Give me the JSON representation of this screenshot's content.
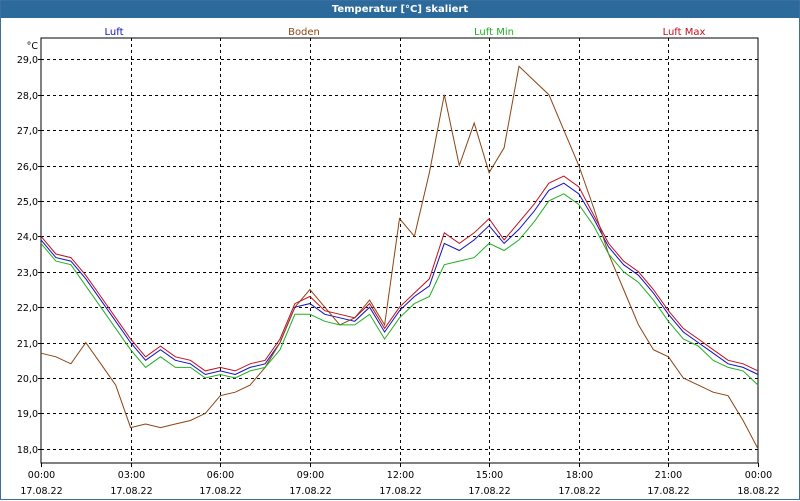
{
  "window": {
    "title": "Temperatur [°C] skaliert"
  },
  "chart_data": {
    "type": "line",
    "title": "Temperatur [°C] skaliert",
    "ylabel": "°C",
    "ylim": [
      17.6,
      29.6
    ],
    "yticks": [
      18.0,
      19.0,
      20.0,
      21.0,
      22.0,
      23.0,
      24.0,
      25.0,
      26.0,
      27.0,
      28.0,
      29.0
    ],
    "ytick_labels": [
      "18,0",
      "19,0",
      "20,0",
      "21,0",
      "22,0",
      "23,0",
      "24,0",
      "25,0",
      "26,0",
      "27,0",
      "28,0",
      "29,0"
    ],
    "xlim": [
      0,
      24
    ],
    "x_ticks": [
      0,
      3,
      6,
      9,
      12,
      15,
      18,
      21,
      24
    ],
    "x_tick_times": [
      "00:00",
      "03:00",
      "06:00",
      "09:00",
      "12:00",
      "15:00",
      "18:00",
      "21:00",
      "00:00"
    ],
    "x_tick_dates": [
      "17.08.22",
      "17.08.22",
      "17.08.22",
      "17.08.22",
      "17.08.22",
      "17.08.22",
      "17.08.22",
      "17.08.22",
      "18.08.22"
    ],
    "grid": true,
    "legend_position": "top",
    "series": [
      {
        "name": "Luft",
        "color": "#1010c0",
        "x": [
          0,
          0.5,
          1,
          1.5,
          2,
          2.5,
          3,
          3.5,
          4,
          4.5,
          5,
          5.5,
          6,
          6.5,
          7,
          7.5,
          8,
          8.5,
          9,
          9.5,
          10,
          10.5,
          11,
          11.5,
          12,
          12.5,
          13,
          13.5,
          14,
          14.5,
          15,
          15.5,
          16,
          16.5,
          17,
          17.5,
          18,
          18.5,
          19,
          19.5,
          20,
          20.5,
          21,
          21.5,
          22,
          22.5,
          23,
          23.5,
          24
        ],
        "y": [
          23.9,
          23.4,
          23.3,
          22.8,
          22.2,
          21.6,
          21.0,
          20.5,
          20.8,
          20.5,
          20.4,
          20.1,
          20.2,
          20.1,
          20.3,
          20.4,
          21.0,
          22.0,
          22.1,
          21.8,
          21.7,
          21.6,
          22.0,
          21.3,
          21.9,
          22.3,
          22.6,
          23.8,
          23.6,
          23.9,
          24.3,
          23.8,
          24.2,
          24.7,
          25.3,
          25.5,
          25.2,
          24.5,
          23.7,
          23.2,
          22.9,
          22.4,
          21.8,
          21.3,
          21.0,
          20.7,
          20.4,
          20.3,
          20.1
        ]
      },
      {
        "name": "Boden",
        "color": "#8b4513",
        "x": [
          0,
          0.5,
          1,
          1.5,
          2,
          2.5,
          3,
          3.5,
          4,
          4.5,
          5,
          5.5,
          6,
          6.5,
          7,
          7.5,
          8,
          8.5,
          9,
          9.5,
          10,
          10.5,
          11,
          11.5,
          12,
          12.5,
          13,
          13.5,
          14,
          14.5,
          15,
          15.5,
          16,
          16.5,
          17,
          17.5,
          18,
          18.5,
          19,
          19.5,
          20,
          20.5,
          21,
          21.5,
          22,
          22.5,
          23,
          23.5,
          24
        ],
        "y": [
          20.7,
          20.6,
          20.4,
          21.0,
          20.4,
          19.8,
          18.6,
          18.7,
          18.6,
          18.7,
          18.8,
          19.0,
          19.5,
          19.6,
          19.8,
          20.3,
          21.0,
          22.0,
          22.5,
          22.0,
          21.5,
          21.7,
          22.2,
          21.5,
          24.5,
          24.0,
          25.8,
          28.0,
          26.0,
          27.2,
          25.8,
          26.5,
          28.8,
          28.4,
          28.0,
          27.0,
          26.0,
          24.8,
          23.5,
          22.5,
          21.5,
          20.8,
          20.6,
          20.0,
          19.8,
          19.6,
          19.5,
          18.8,
          18.0
        ]
      },
      {
        "name": "Luft Min",
        "color": "#20b020",
        "x": [
          0,
          0.5,
          1,
          1.5,
          2,
          2.5,
          3,
          3.5,
          4,
          4.5,
          5,
          5.5,
          6,
          6.5,
          7,
          7.5,
          8,
          8.5,
          9,
          9.5,
          10,
          10.5,
          11,
          11.5,
          12,
          12.5,
          13,
          13.5,
          14,
          14.5,
          15,
          15.5,
          16,
          16.5,
          17,
          17.5,
          18,
          18.5,
          19,
          19.5,
          20,
          20.5,
          21,
          21.5,
          22,
          22.5,
          23,
          23.5,
          24
        ],
        "y": [
          23.8,
          23.3,
          23.2,
          22.6,
          22.0,
          21.4,
          20.8,
          20.3,
          20.6,
          20.3,
          20.3,
          20.0,
          20.1,
          20.0,
          20.2,
          20.3,
          20.8,
          21.8,
          21.8,
          21.6,
          21.5,
          21.5,
          21.8,
          21.1,
          21.7,
          22.1,
          22.3,
          23.2,
          23.3,
          23.4,
          23.8,
          23.6,
          23.9,
          24.4,
          25.0,
          25.2,
          24.9,
          24.3,
          23.5,
          23.0,
          22.7,
          22.2,
          21.6,
          21.1,
          20.9,
          20.5,
          20.3,
          20.2,
          19.8
        ]
      },
      {
        "name": "Luft Max",
        "color": "#c01020",
        "x": [
          0,
          0.5,
          1,
          1.5,
          2,
          2.5,
          3,
          3.5,
          4,
          4.5,
          5,
          5.5,
          6,
          6.5,
          7,
          7.5,
          8,
          8.5,
          9,
          9.5,
          10,
          10.5,
          11,
          11.5,
          12,
          12.5,
          13,
          13.5,
          14,
          14.5,
          15,
          15.5,
          16,
          16.5,
          17,
          17.5,
          18,
          18.5,
          19,
          19.5,
          20,
          20.5,
          21,
          21.5,
          22,
          22.5,
          23,
          23.5,
          24
        ],
        "y": [
          24.0,
          23.5,
          23.4,
          22.9,
          22.3,
          21.7,
          21.1,
          20.6,
          20.9,
          20.6,
          20.5,
          20.2,
          20.3,
          20.2,
          20.4,
          20.5,
          21.1,
          22.1,
          22.3,
          21.9,
          21.8,
          21.7,
          22.1,
          21.4,
          22.0,
          22.4,
          22.8,
          24.1,
          23.8,
          24.1,
          24.5,
          23.9,
          24.4,
          24.9,
          25.5,
          25.7,
          25.4,
          24.6,
          23.8,
          23.3,
          23.0,
          22.5,
          21.9,
          21.4,
          21.1,
          20.8,
          20.5,
          20.4,
          20.2
        ]
      }
    ]
  }
}
